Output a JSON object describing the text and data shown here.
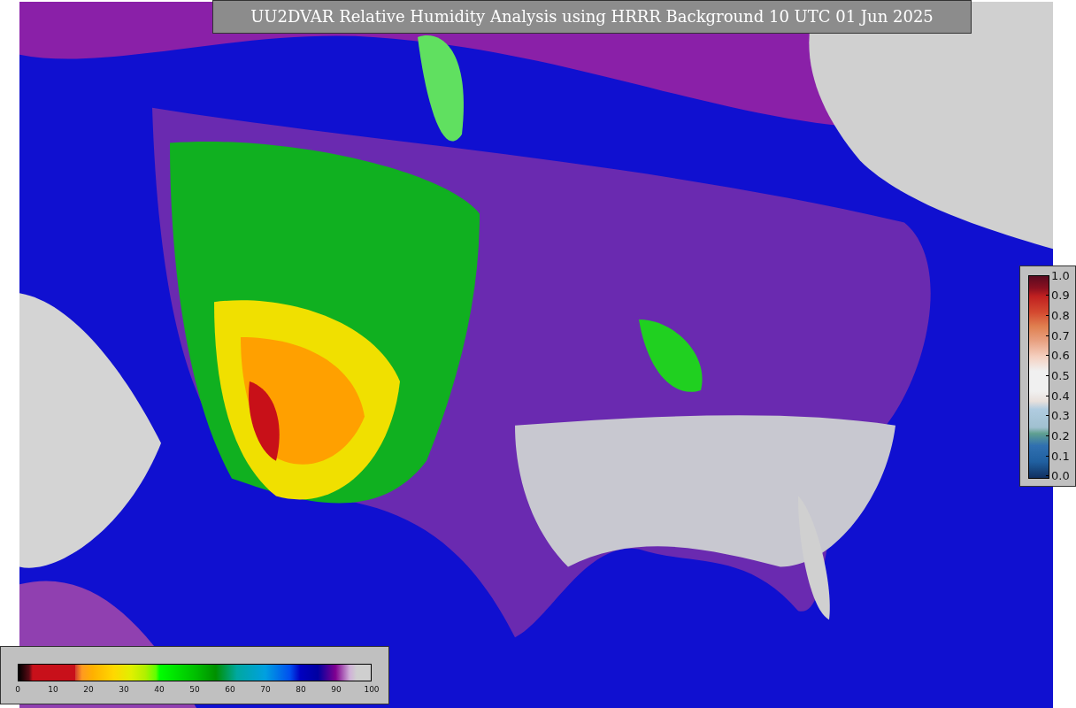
{
  "title": "UU2DVAR Relative Humidity Analysis using HRRR Background 10 UTC 01 Jun 2025",
  "observation_colorbar": {
    "ticks": [
      "1.0",
      "0.9",
      "0.8",
      "0.7",
      "0.6",
      "0.5",
      "0.4",
      "0.3",
      "0.2",
      "0.1",
      "0.0"
    ]
  },
  "humidity_colorbar": {
    "ticks": [
      "0",
      "10",
      "20",
      "30",
      "40",
      "50",
      "60",
      "70",
      "80",
      "90",
      "100"
    ]
  }
}
